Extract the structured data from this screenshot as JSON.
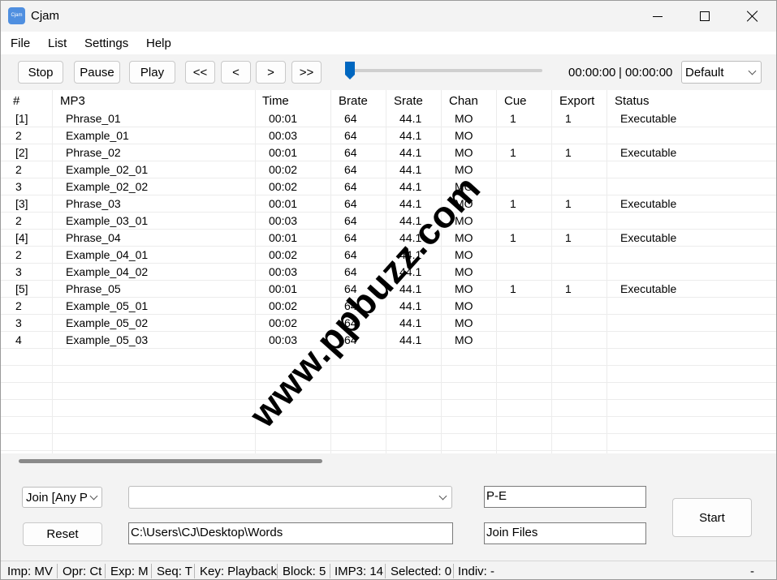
{
  "window": {
    "title": "Cjam",
    "icon_text": "Cjam"
  },
  "menu": [
    "File",
    "List",
    "Settings",
    "Help"
  ],
  "toolbar": {
    "buttons": [
      "Stop",
      "Pause",
      "Play",
      "<<",
      "<",
      ">",
      ">>"
    ],
    "time_current": "00:00:00",
    "time_sep": "|",
    "time_total": "00:00:00",
    "profile": "Default",
    "seek_position": 0
  },
  "table": {
    "columns": [
      "#",
      "MP3",
      "Time",
      "Brate",
      "Srate",
      "Chan",
      "Cue",
      "Export",
      "Status"
    ],
    "rows": [
      [
        "[1]",
        "Phrase_01",
        "00:01",
        "64",
        "44.1",
        "MO",
        "1",
        "1",
        "Executable"
      ],
      [
        "2",
        "Example_01",
        "00:03",
        "64",
        "44.1",
        "MO",
        "",
        "",
        ""
      ],
      [
        "[2]",
        "Phrase_02",
        "00:01",
        "64",
        "44.1",
        "MO",
        "1",
        "1",
        "Executable"
      ],
      [
        "2",
        "Example_02_01",
        "00:02",
        "64",
        "44.1",
        "MO",
        "",
        "",
        ""
      ],
      [
        "3",
        "Example_02_02",
        "00:02",
        "64",
        "44.1",
        "MO",
        "",
        "",
        ""
      ],
      [
        "[3]",
        "Phrase_03",
        "00:01",
        "64",
        "44.1",
        "MO",
        "1",
        "1",
        "Executable"
      ],
      [
        "2",
        "Example_03_01",
        "00:03",
        "64",
        "44.1",
        "MO",
        "",
        "",
        ""
      ],
      [
        "[4]",
        "Phrase_04",
        "00:01",
        "64",
        "44.1",
        "MO",
        "1",
        "1",
        "Executable"
      ],
      [
        "2",
        "Example_04_01",
        "00:02",
        "64",
        "44.1",
        "MO",
        "",
        "",
        ""
      ],
      [
        "3",
        "Example_04_02",
        "00:03",
        "64",
        "44.1",
        "MO",
        "",
        "",
        ""
      ],
      [
        "[5]",
        "Phrase_05",
        "00:01",
        "64",
        "44.1",
        "MO",
        "1",
        "1",
        "Executable"
      ],
      [
        "2",
        "Example_05_01",
        "00:02",
        "64",
        "44.1",
        "MO",
        "",
        "",
        ""
      ],
      [
        "3",
        "Example_05_02",
        "00:02",
        "64",
        "44.1",
        "MO",
        "",
        "",
        ""
      ],
      [
        "4",
        "Example_05_03",
        "00:03",
        "64",
        "44.1",
        "MO",
        "",
        "",
        ""
      ]
    ]
  },
  "watermark": "www.ppbuzz.com",
  "panel": {
    "join_mode": "Join [Any P",
    "combo_value": "",
    "reset_label": "Reset",
    "path": "C:\\Users\\CJ\\Desktop\\Words",
    "pattern": "P-E",
    "output_name": "Join Files",
    "start_label": "Start"
  },
  "status": [
    "Imp: MV",
    "Opr: Ct",
    "Exp: M",
    "Seq: T",
    "Key: Playback",
    "Block: 5",
    "IMP3: 14",
    "Selected: 0",
    "Indiv: -"
  ],
  "status_right": "-",
  "colors": {
    "accent": "#0067c0",
    "window_bg": "#f3f3f3",
    "grid_bg": "#ffffff"
  }
}
